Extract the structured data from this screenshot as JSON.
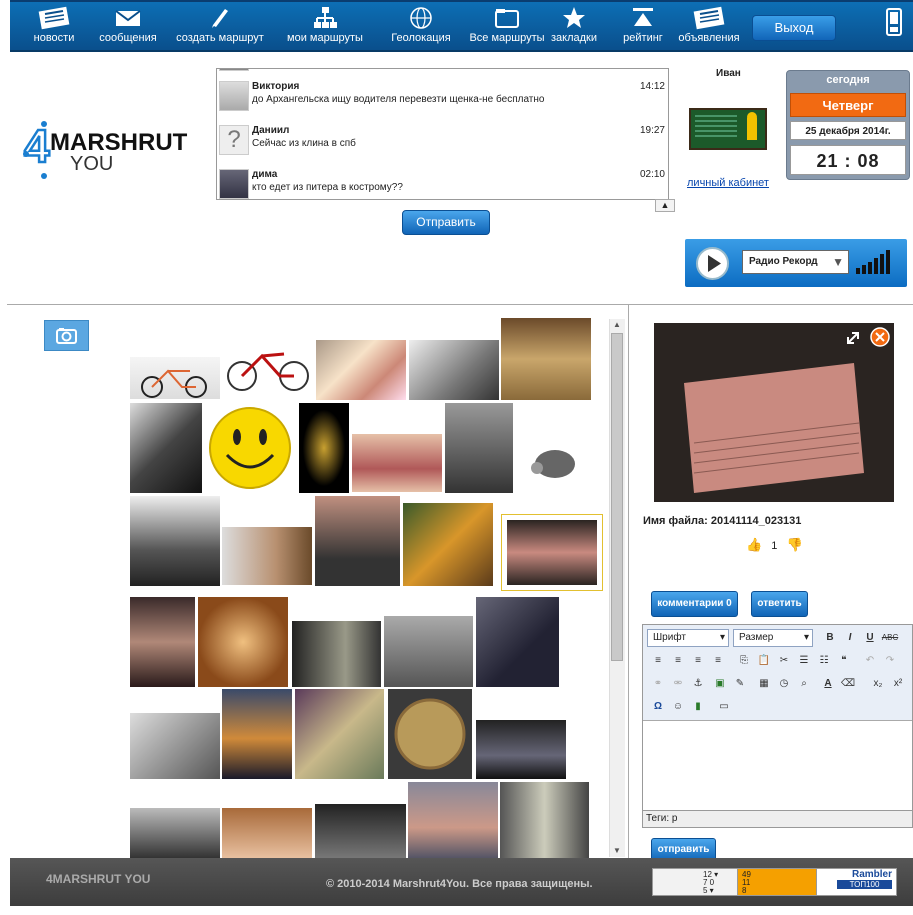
{
  "nav": {
    "items": [
      {
        "label": "новости",
        "icon": "newspaper-icon"
      },
      {
        "label": "сообщения",
        "icon": "envelope-icon"
      },
      {
        "label": "создать маршрут",
        "icon": "pencil-icon"
      },
      {
        "label": "мои маршруты",
        "icon": "hierarchy-icon"
      },
      {
        "label": "Геолокация",
        "icon": "globe-icon"
      },
      {
        "label": "Все маршруты",
        "icon": "folder-icon"
      },
      {
        "label": "закладки",
        "icon": "star-icon"
      },
      {
        "label": "рейтинг",
        "icon": "rating-icon"
      },
      {
        "label": "объявления",
        "icon": "newspaper-icon"
      }
    ],
    "exit_label": "Выход"
  },
  "logo": {
    "main": "MARSHRUT",
    "sub": "YOU",
    "prefix": "4"
  },
  "chat": {
    "messages": [
      {
        "name": "Виктория",
        "text": "до Архангельска ищу водителя перевезти щенка-не бесплатно",
        "time": "14:12"
      },
      {
        "name": "Даниил",
        "text": "Сейчас из клина в спб",
        "time": "19:27"
      },
      {
        "name": "дима",
        "text": "кто едет из питера в кострому??",
        "time": "02:10"
      }
    ],
    "send_label": "Отправить"
  },
  "user": {
    "name": "Иван",
    "cabinet_link": "личный кабинет"
  },
  "calendar": {
    "today_label": "сегодня",
    "weekday": "Четверг",
    "date": "25 декабря 2014г.",
    "time": "21 : 08"
  },
  "radio": {
    "station": "Радио Рекорд"
  },
  "gallery": {
    "filename_label": "Имя файла:",
    "filename": "20141114_023131",
    "likes": "1",
    "comments_label": "комментарии 0",
    "reply_label": "ответить"
  },
  "editor": {
    "font_label": "Шрифт",
    "size_label": "Размер",
    "tags_label": "Теги: p",
    "submit_label": "отправить"
  },
  "footer": {
    "logo": "4MARSHRUT YOU",
    "copyright": "© 2010-2014 Marshrut4You. Все права защищены.",
    "counter1": "12 ▾\n7 0\n5 ▾",
    "counter2": "49\n11\n8",
    "rambler": "Rambler",
    "rambler_sub": "ТОП100"
  },
  "colors": {
    "nav_blue": "#0d6fb5",
    "orange": "#f26a12",
    "footer": "#4a4a4a",
    "link": "#0645ad"
  }
}
